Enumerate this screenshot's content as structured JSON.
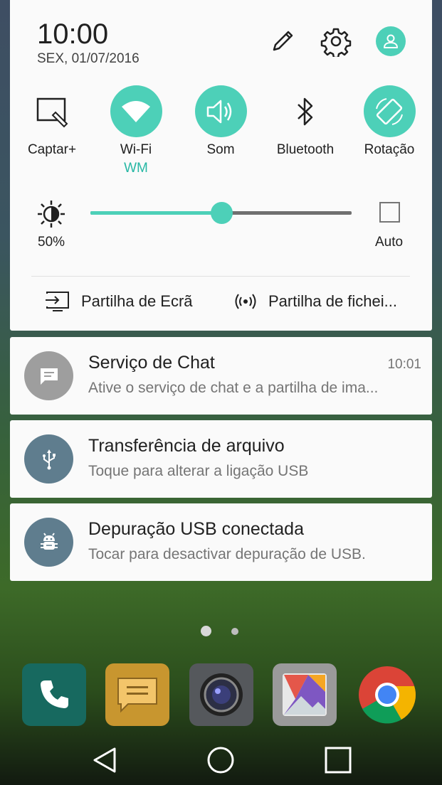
{
  "header": {
    "time": "10:00",
    "date": "SEX, 01/07/2016"
  },
  "top_icons": [
    "edit-icon",
    "settings-icon",
    "user-icon"
  ],
  "quick_settings": [
    {
      "label": "Captar+",
      "icon": "capture-icon",
      "active": false
    },
    {
      "label": "Wi-Fi",
      "sub": "WM",
      "icon": "wifi-icon",
      "active": true
    },
    {
      "label": "Som",
      "icon": "sound-icon",
      "active": true
    },
    {
      "label": "Bluetooth",
      "icon": "bluetooth-icon",
      "active": false
    },
    {
      "label": "Rotação",
      "icon": "rotation-icon",
      "active": true
    }
  ],
  "brightness": {
    "value_label": "50%",
    "level": 0.5,
    "auto_label": "Auto",
    "auto_checked": false
  },
  "share": [
    {
      "label": "Partilha de Ecrã",
      "icon": "screen-share-icon"
    },
    {
      "label": "Partilha de fichei...",
      "icon": "file-share-icon"
    }
  ],
  "notifications": [
    {
      "title": "Serviço de Chat",
      "text": "Ative o serviço de chat e a partilha de ima...",
      "time": "10:01",
      "icon": "chat-icon",
      "icon_color": "#9e9e9e"
    },
    {
      "title": "Transferência de arquivo",
      "text": "Toque para alterar a ligação USB",
      "time": "",
      "icon": "usb-icon",
      "icon_color": "#5f7d8e"
    },
    {
      "title": "Depuração USB conectada",
      "text": "Tocar para desactivar depuração de USB.",
      "time": "",
      "icon": "android-debug-icon",
      "icon_color": "#5f7d8e"
    }
  ],
  "colors": {
    "accent": "#4dd0b8",
    "panel": "#fafafa"
  },
  "dock": [
    "phone-app-icon",
    "messages-app-icon",
    "camera-app-icon",
    "gallery-app-icon",
    "chrome-app-icon"
  ],
  "nav": [
    "back-icon",
    "home-icon",
    "recents-icon"
  ]
}
